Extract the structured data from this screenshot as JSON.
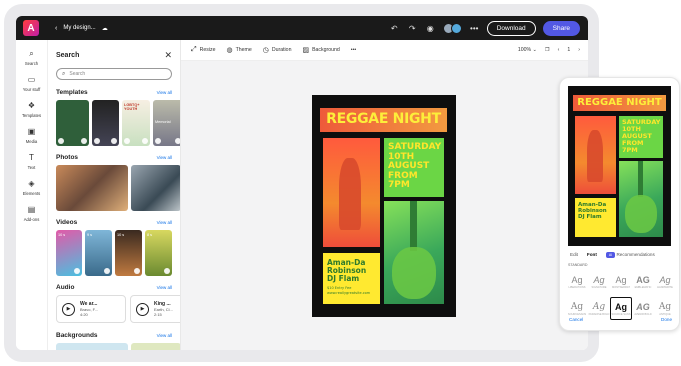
{
  "topbar": {
    "doc_title": "My design...",
    "download_label": "Download",
    "share_label": "Share",
    "colors": {
      "share_bg": "#5258e4",
      "bar_bg": "#1a1a1a"
    }
  },
  "rail": {
    "items": [
      {
        "label": "Search",
        "icon": "search-icon"
      },
      {
        "label": "Your stuff",
        "icon": "folder-icon"
      },
      {
        "label": "Templates",
        "icon": "templates-icon"
      },
      {
        "label": "Media",
        "icon": "media-icon"
      },
      {
        "label": "Text",
        "icon": "text-icon"
      },
      {
        "label": "Elements",
        "icon": "elements-icon"
      },
      {
        "label": "Add-ons",
        "icon": "addons-icon"
      }
    ]
  },
  "panel": {
    "title": "Search",
    "search_placeholder": "Search",
    "view_all": "View all",
    "sections": {
      "templates": "Templates",
      "photos": "Photos",
      "videos": "Videos",
      "audio": "Audio",
      "backgrounds": "Backgrounds"
    },
    "template_thumbs": [
      "",
      "",
      "LGBTQ+ YOUTH",
      "Memorial"
    ],
    "video_durations": [
      "10 s",
      "9 s",
      "10 s",
      "8 s"
    ],
    "audio_tracks": [
      {
        "name": "We ar...",
        "artist": "Bravo, F...",
        "duration": "4:20"
      },
      {
        "name": "King ...",
        "artist": "Earth, Cl...",
        "duration": "2:15"
      }
    ]
  },
  "toolbar": {
    "resize": "Resize",
    "theme": "Theme",
    "duration": "Duration",
    "background": "Background",
    "zoom": "100%",
    "page": "1"
  },
  "poster": {
    "title": "REGGAE NIGHT",
    "date_lines": [
      "SATURDAY",
      "10TH",
      "AUGUST",
      "FROM 7PM"
    ],
    "performer_lines": [
      "Aman-Da",
      "Robinson",
      "DJ Flam"
    ],
    "small_lines": [
      "$10 Entry Fee",
      "www.reallygreatsite.com"
    ],
    "colors": {
      "banner": "#ee5a3a",
      "title": "#fdee3a",
      "date_bg": "#6bd645",
      "perf_bg": "#ffe930",
      "bg": "#0e0e0e"
    }
  },
  "phone": {
    "tabs": [
      "Edit",
      "Font",
      "Recommendations"
    ],
    "ai_badge": "AI",
    "standard_label": "STANDARD",
    "fonts": [
      {
        "glyph": "Ag",
        "name": "LIBERATIONS"
      },
      {
        "glyph": "Ag",
        "name": "SIGNATURE"
      },
      {
        "glyph": "Ag",
        "name": "MONTSERRAT"
      },
      {
        "glyph": "AG",
        "name": "EMBLEMATIC"
      },
      {
        "glyph": "Ag",
        "name": "HANDWRITE"
      },
      {
        "glyph": "Ag",
        "name": "SOURCESANS"
      },
      {
        "glyph": "Ag",
        "name": "PARADISE BOLD"
      },
      {
        "glyph": "Ag",
        "name": "SOURCE SANS"
      },
      {
        "glyph": "AG",
        "name": "AVENIR BOLD"
      },
      {
        "glyph": "Ag",
        "name": "ANTIQUE"
      }
    ],
    "selected_font_index": 7,
    "cancel": "Cancel",
    "done": "Done"
  }
}
